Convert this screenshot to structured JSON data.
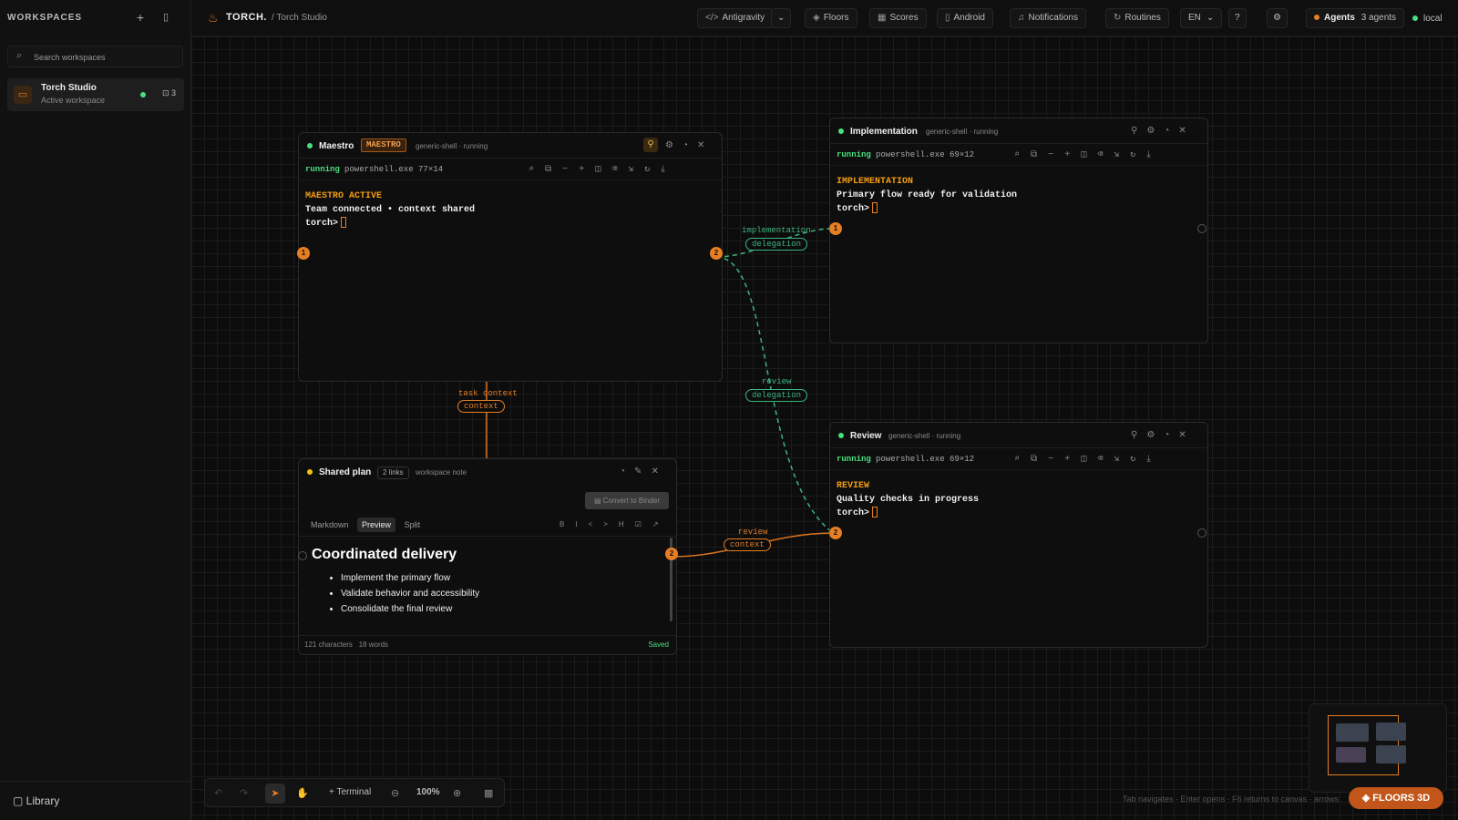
{
  "sidebar": {
    "heading": "WORKSPACES",
    "add_icon": "plus-icon",
    "collapse_icon": "panel-icon",
    "search_placeholder": "Search workspaces",
    "workspace": {
      "name": "Torch Studio",
      "status": "Active workspace",
      "count": "3"
    },
    "library_label": "Library"
  },
  "topbar": {
    "brand": "TORCH.",
    "breadcrumb": "/ Torch Studio",
    "buttons": {
      "antigravity": "Antigravity",
      "floors": "Floors",
      "scores": "Scores",
      "android": "Android",
      "notifications": "Notifications",
      "routines": "Routines",
      "language": "EN"
    },
    "agents_label": "Agents",
    "agents_count": "3 agents",
    "env": "local"
  },
  "panels": {
    "maestro": {
      "title": "Maestro",
      "tag": "MAESTRO",
      "meta": "generic-shell · running",
      "state": "running",
      "process": "powershell.exe 77×14",
      "lines": [
        "MAESTRO ACTIVE",
        "Team connected • context shared",
        "torch>"
      ],
      "ports": [
        "1",
        "2"
      ]
    },
    "implementation": {
      "title": "Implementation",
      "meta": "generic-shell · running",
      "state": "running",
      "process": "powershell.exe 69×12",
      "lines": [
        "IMPLEMENTATION",
        "Primary flow ready for validation",
        "torch>"
      ],
      "port": "1"
    },
    "review": {
      "title": "Review",
      "meta": "generic-shell · running",
      "state": "running",
      "process": "powershell.exe 69×12",
      "lines": [
        "REVIEW",
        "Quality checks in progress",
        "torch>"
      ],
      "port": "2"
    },
    "shared_plan": {
      "title": "Shared plan",
      "links": "2 links",
      "meta": "workspace note",
      "convert_label": "Convert to Binder",
      "tabs": [
        "Markdown",
        "Preview",
        "Split"
      ],
      "active_tab": "Preview",
      "format_buttons": [
        "B",
        "I",
        "<>",
        "H",
        "☑",
        "↗"
      ],
      "heading": "Coordinated delivery",
      "items": [
        "Implement the primary flow",
        "Validate behavior and accessibility",
        "Consolidate the final review"
      ],
      "chars": "121 characters",
      "words": "18 words",
      "saved": "Saved",
      "port": "2"
    }
  },
  "links": {
    "impl": {
      "label": "implementation",
      "kind": "delegation"
    },
    "review": {
      "label": "review",
      "kind": "delegation"
    },
    "task": {
      "label": "task context",
      "kind": "context"
    },
    "note_review": {
      "label": "review",
      "kind": "context"
    }
  },
  "bottom_bar": {
    "terminal_label": "Terminal",
    "zoom": "100%"
  },
  "hint": "Tab navigates · Enter opens · F6 returns to canvas · arrows",
  "floors3d_label": "FLOORS 3D",
  "colors": {
    "accent": "#e67e22",
    "running": "#4ade80",
    "delegation": "#3fb37f"
  }
}
